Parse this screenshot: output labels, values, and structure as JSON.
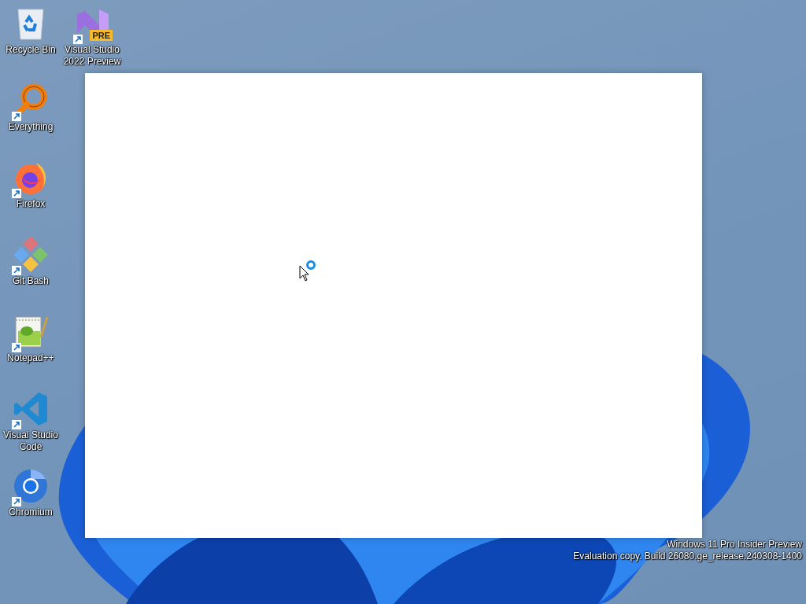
{
  "desktop_icon_columns": [
    [
      {
        "label": "Recycle Bin",
        "kind": "recycle-bin",
        "shortcut": false
      },
      {
        "label": "Everything",
        "kind": "everything",
        "shortcut": true
      },
      {
        "label": "Firefox",
        "kind": "firefox",
        "shortcut": true
      },
      {
        "label": "Git Bash",
        "kind": "git-bash",
        "shortcut": true
      },
      {
        "label": "Notepad++",
        "kind": "notepad",
        "shortcut": true
      },
      {
        "label": "Visual Studio Code",
        "kind": "vscode",
        "shortcut": true
      },
      {
        "label": "Chromium",
        "kind": "chromium",
        "shortcut": true
      }
    ],
    [
      {
        "label": "Visual Studio 2022 Preview",
        "kind": "vs-preview",
        "shortcut": true,
        "badge": "PRE"
      }
    ]
  ],
  "system_notice": [
    "Windows 11 Pro Insider Preview",
    "Evaluation copy. Build 26080.ge_release.240308-1400"
  ]
}
